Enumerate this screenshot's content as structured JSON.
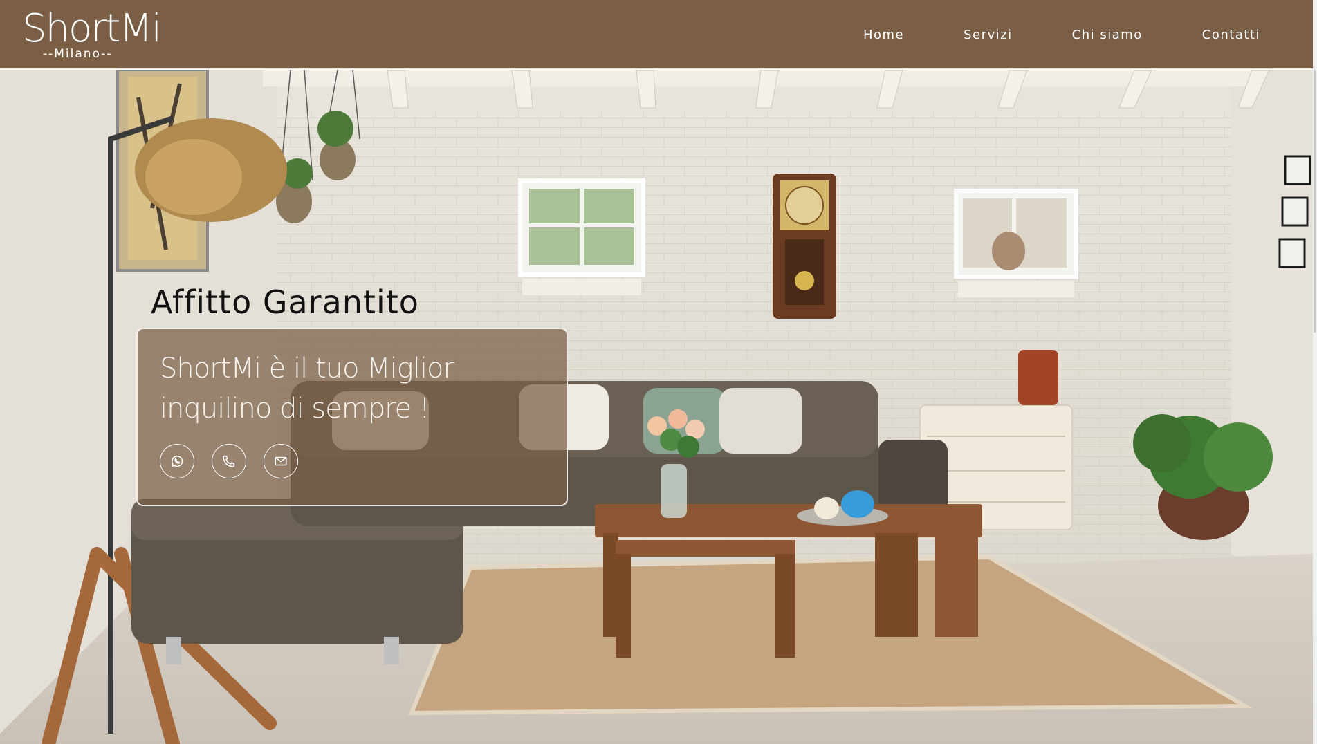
{
  "header": {
    "logo_text": "ShortMi",
    "logo_subtitle": "--Milano--",
    "nav": [
      {
        "label": "Home"
      },
      {
        "label": "Servizi"
      },
      {
        "label": "Chi siamo"
      },
      {
        "label": "Contatti"
      }
    ],
    "background_color": "#7a5e45"
  },
  "hero": {
    "title": "Affitto Garantito",
    "card": {
      "text": "ShortMi  è il tuo Miglior inquilino di sempre !",
      "icons": [
        "whatsapp-icon",
        "phone-icon",
        "mail-icon"
      ]
    }
  }
}
